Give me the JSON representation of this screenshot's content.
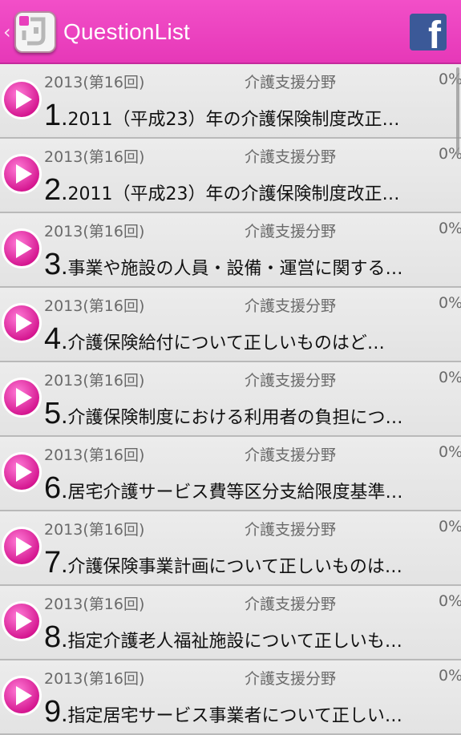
{
  "appbar": {
    "title": "QuestionList",
    "back_icon": "chevron-left-icon",
    "app_icon": "app-logo-icon",
    "share_icon": "facebook-icon",
    "brand_color": "#e83fbc"
  },
  "rows": [
    {
      "year": "2013(第16回)",
      "category": "介護支援分野",
      "progress": "0%",
      "number": "1",
      "text": "2011（平成23）年の介護保険制度改正…"
    },
    {
      "year": "2013(第16回)",
      "category": "介護支援分野",
      "progress": "0%",
      "number": "2",
      "text": "2011（平成23）年の介護保険制度改正…"
    },
    {
      "year": "2013(第16回)",
      "category": "介護支援分野",
      "progress": "0%",
      "number": "3",
      "text": "事業や施設の人員・設備・運営に関する…"
    },
    {
      "year": "2013(第16回)",
      "category": "介護支援分野",
      "progress": "0%",
      "number": "4",
      "text": "介護保険給付について正しいものはど…"
    },
    {
      "year": "2013(第16回)",
      "category": "介護支援分野",
      "progress": "0%",
      "number": "5",
      "text": "介護保険制度における利用者の負担につ…"
    },
    {
      "year": "2013(第16回)",
      "category": "介護支援分野",
      "progress": "0%",
      "number": "6",
      "text": "居宅介護サービス費等区分支給限度基準…"
    },
    {
      "year": "2013(第16回)",
      "category": "介護支援分野",
      "progress": "0%",
      "number": "7",
      "text": "介護保険事業計画について正しいものは…"
    },
    {
      "year": "2013(第16回)",
      "category": "介護支援分野",
      "progress": "0%",
      "number": "8",
      "text": "指定介護老人福祉施設について正しいも…"
    },
    {
      "year": "2013(第16回)",
      "category": "介護支援分野",
      "progress": "0%",
      "number": "9",
      "text": "指定居宅サービス事業者について正しい…"
    }
  ]
}
